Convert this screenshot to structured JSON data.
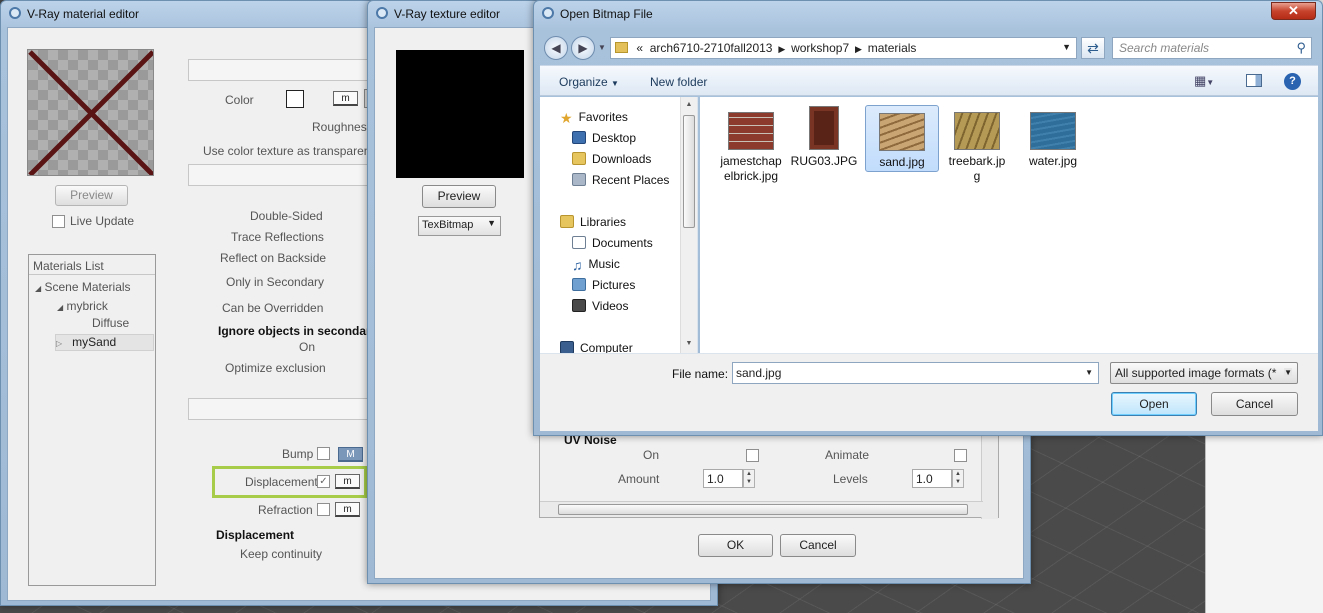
{
  "material_editor": {
    "title": "V-Ray material editor",
    "preview_button": "Preview",
    "live_update": "Live Update",
    "color_label": "Color",
    "roughness_label": "Roughness",
    "use_color_texture": "Use color texture as transparency",
    "m_label": "m",
    "M_label": "M",
    "options": [
      "Double-Sided",
      "Trace Reflections",
      "Reflect on Backside",
      "Only in Secondary",
      "Can be Overridden"
    ],
    "ignore_heading": "Ignore objects in secondar",
    "on_label": "On",
    "optimize_exclusion": "Optimize exclusion",
    "bump_label": "Bump",
    "displacement_label": "Displacement",
    "refraction_label": "Refraction",
    "displacement_heading": "Displacement",
    "keep_continuity": "Keep continuity",
    "materials_list": {
      "header": "Materials List",
      "items": [
        "Scene Materials",
        "mybrick",
        "Diffuse",
        "mySand"
      ]
    }
  },
  "texture_editor": {
    "title": "V-Ray texture editor",
    "preview_button": "Preview",
    "texture_type": "TexBitmap",
    "uv_noise_heading": "UV Noise",
    "on_label": "On",
    "animate_label": "Animate",
    "amount_label": "Amount",
    "amount_value": "1.0",
    "levels_label": "Levels",
    "levels_value": "1.0",
    "ok_button": "OK",
    "cancel_button": "Cancel"
  },
  "open_bitmap": {
    "title": "Open Bitmap File",
    "breadcrumb": [
      "arch6710-2710fall2013",
      "workshop7",
      "materials"
    ],
    "breadcrumb_prefix": "«",
    "search_placeholder": "Search materials",
    "organize": "Organize",
    "new_folder": "New folder",
    "nav": {
      "favorites": "Favorites",
      "favorite_items": [
        "Desktop",
        "Downloads",
        "Recent Places"
      ],
      "libraries": "Libraries",
      "library_items": [
        "Documents",
        "Music",
        "Pictures",
        "Videos"
      ],
      "computer": "Computer"
    },
    "files": [
      {
        "name": "jamestchapelbrick.jpg",
        "line1": "jamestchap",
        "line2": "elbrick.jpg",
        "color": "#8b3a2c"
      },
      {
        "name": "RUG03.JPG",
        "line1": "RUG03.JPG",
        "line2": "",
        "color": "#5a2318"
      },
      {
        "name": "sand.jpg",
        "line1": "sand.jpg",
        "line2": "",
        "color": "#b89060"
      },
      {
        "name": "treebark.jpg",
        "line1": "treebark.jp",
        "line2": "g",
        "color": "#a88a4a"
      },
      {
        "name": "water.jpg",
        "line1": "water.jpg",
        "line2": "",
        "color": "#2f6e9a"
      }
    ],
    "file_name_label": "File name:",
    "file_name_value": "sand.jpg",
    "file_type": "All supported image formats (*",
    "open_button": "Open",
    "cancel_button": "Cancel"
  }
}
